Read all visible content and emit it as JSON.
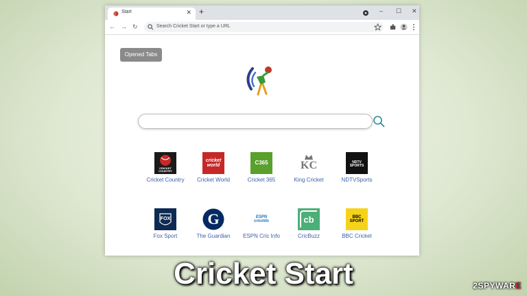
{
  "browser": {
    "tab_title": "Start",
    "tab_close": "✕",
    "new_tab": "+",
    "controls": {
      "minimize": "–",
      "maximize": "☐",
      "close": "✕"
    },
    "nav": {
      "back": "←",
      "forward": "→",
      "reload": "↻"
    },
    "address_placeholder": "Search Cricket Start or type a URL",
    "icons": [
      "star-icon",
      "extensions-icon",
      "profile-icon",
      "menu-icon"
    ]
  },
  "page": {
    "opened_tabs_label": "Opened Tabs",
    "search_placeholder": "",
    "sites": [
      {
        "label": "Cricket Country",
        "tile_text": "CRICKET COUNTRY",
        "bg": "#1a1a1a"
      },
      {
        "label": "Cricket World",
        "tile_text": "cricket world",
        "bg": "#c62828"
      },
      {
        "label": "Cricket 365",
        "tile_text": "C365",
        "bg": "#5aa02c"
      },
      {
        "label": "King Cricket",
        "tile_text": "KC",
        "bg": "#ffffff"
      },
      {
        "label": "NDTVSports",
        "tile_text": "NDTV SPORTS",
        "bg": "#111111"
      },
      {
        "label": "Fox Sport",
        "tile_text": "FOX",
        "bg": "#0d2a52"
      },
      {
        "label": "The Guardian",
        "tile_text": "G",
        "bg": "#ffffff"
      },
      {
        "label": "ESPN Cric Info",
        "tile_text": "ESPN cricinfo",
        "bg": "#ffffff"
      },
      {
        "label": "CricBuzz",
        "tile_text": "cb",
        "bg": "#4caf78"
      },
      {
        "label": "BBC Cricket",
        "tile_text": "BBC SPORT",
        "bg": "#f6d31b"
      }
    ]
  },
  "caption": "Cricket Start",
  "watermark": {
    "prefix": "2",
    "brand": "SPYWAR",
    "suffix": "E"
  },
  "colors": {
    "accent": "#3d5ea8",
    "search_icon": "#2a8a9a"
  }
}
